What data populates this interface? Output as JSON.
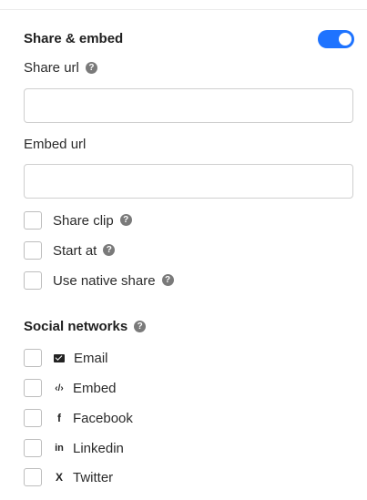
{
  "share": {
    "title": "Share & embed",
    "toggle_on": true,
    "share_url_label": "Share url",
    "share_url_value": "",
    "embed_url_label": "Embed url",
    "embed_url_value": "",
    "options": [
      {
        "label": "Share clip",
        "help": "?"
      },
      {
        "label": "Start at",
        "help": "?"
      },
      {
        "label": "Use native share",
        "help": "?"
      }
    ]
  },
  "social": {
    "title": "Social networks",
    "help": "?",
    "networks": [
      {
        "label": "Email",
        "icon": "envelope-icon"
      },
      {
        "label": "Embed",
        "icon": "code-icon",
        "glyph": "‹/›"
      },
      {
        "label": "Facebook",
        "icon": "facebook-icon",
        "glyph": "f"
      },
      {
        "label": "Linkedin",
        "icon": "linkedin-icon",
        "glyph": "in"
      },
      {
        "label": "Twitter",
        "icon": "x-icon",
        "glyph": "X"
      }
    ]
  },
  "colors": {
    "accent": "#1e73ff",
    "help_icon": "#7a7a7a",
    "border": "#cfcfcf"
  }
}
